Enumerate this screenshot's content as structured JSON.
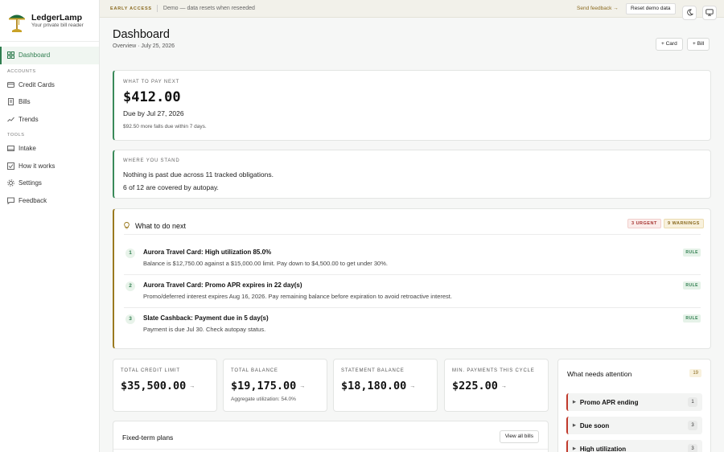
{
  "brand": {
    "name": "LedgerLamp",
    "tagline": "Your private bill reader"
  },
  "nav": {
    "dashboard": "Dashboard",
    "accounts_header": "ACCOUNTS",
    "accounts": [
      "Credit Cards",
      "Bills",
      "Trends"
    ],
    "tools_header": "TOOLS",
    "tools": [
      "Intake",
      "How it works",
      "Settings",
      "Feedback"
    ]
  },
  "banner": {
    "tag": "EARLY ACCESS",
    "text": "Demo — data resets when reseeded",
    "feedback": "Send feedback →",
    "reset": "Reset demo data"
  },
  "header": {
    "title": "Dashboard",
    "subtitle": "Overview · July 25, 2026",
    "add_card": "+ Card",
    "add_bill": "+ Bill"
  },
  "pay_next": {
    "eyebrow": "WHAT TO PAY NEXT",
    "amount": "$412.00",
    "due": "Due by Jul 27, 2026",
    "note": "$92.50 more falls due within 7 days."
  },
  "standing": {
    "eyebrow": "WHERE YOU STAND",
    "line1": "Nothing is past due across 11 tracked obligations.",
    "line2": "6 of 12 are covered by autopay."
  },
  "todo": {
    "title": "What to do next",
    "urgent": "3 URGENT",
    "warnings": "9 WARNINGS",
    "items": [
      {
        "num": "1",
        "title": "Aurora Travel Card: High utilization 85.0%",
        "desc": "Balance is $12,750.00 against a $15,000.00 limit. Pay down to $4,500.00 to get under 30%.",
        "badge": "RULE"
      },
      {
        "num": "2",
        "title": "Aurora Travel Card: Promo APR expires in 22 day(s)",
        "desc": "Promo/deferred interest expires Aug 16, 2026. Pay remaining balance before expiration to avoid retroactive interest.",
        "badge": "RULE"
      },
      {
        "num": "3",
        "title": "Slate Cashback: Payment due in 5 day(s)",
        "desc": "Payment is due Jul 30. Check autopay status.",
        "badge": "RULE"
      }
    ]
  },
  "stats": [
    {
      "label": "TOTAL CREDIT LIMIT",
      "value": "$35,500.00",
      "arrow": "→",
      "note": ""
    },
    {
      "label": "TOTAL BALANCE",
      "value": "$19,175.00",
      "arrow": "→",
      "note": "Aggregate utilization: 54.0%"
    },
    {
      "label": "STATEMENT BALANCE",
      "value": "$18,180.00",
      "arrow": "→",
      "note": ""
    },
    {
      "label": "MIN. PAYMENTS THIS CYCLE",
      "value": "$225.00",
      "arrow": "→",
      "note": ""
    }
  ],
  "attention": {
    "title": "What needs attention",
    "total": "19",
    "items": [
      {
        "label": "Promo APR ending",
        "count": "1"
      },
      {
        "label": "Due soon",
        "count": "3"
      },
      {
        "label": "High utilization",
        "count": "3"
      }
    ]
  },
  "plans": {
    "title": "Fixed-term plans",
    "view_all": "View all bills"
  },
  "colors": {
    "accent": "#2f7d4f",
    "warning": "#9a7a20",
    "urgent": "#c0392b"
  }
}
